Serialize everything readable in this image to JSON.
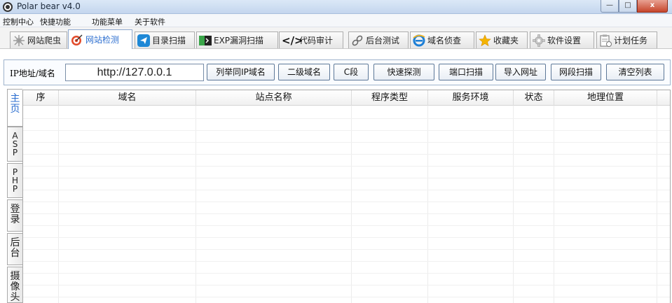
{
  "window": {
    "title": "Polar bear v4.0",
    "min": "—",
    "max": "□",
    "close": "x"
  },
  "menu": [
    "控制中心",
    "快捷功能",
    "功能菜单",
    "关于软件"
  ],
  "tabs": [
    {
      "label": "网站爬虫",
      "icon": "spider-icon"
    },
    {
      "label": "网站检测",
      "icon": "target-icon"
    },
    {
      "label": "目录扫描",
      "icon": "send-icon"
    },
    {
      "label": "EXP漏洞扫描",
      "icon": "terminal-icon"
    },
    {
      "label": "代码审计",
      "icon": "code-icon",
      "glyph": "</>"
    },
    {
      "label": "后台测试",
      "icon": "link-icon"
    },
    {
      "label": "域名侦查",
      "icon": "ie-icon"
    },
    {
      "label": "收藏夹",
      "icon": "star-icon"
    },
    {
      "label": "软件设置",
      "icon": "gear-icon"
    },
    {
      "label": "计划任务",
      "icon": "clipboard-icon"
    }
  ],
  "toolbar": {
    "ip_label": "IP地址/域名",
    "ip_value": "http://127.0.0.1",
    "buttons": [
      "列举同IP域名",
      "二级域名",
      "C段",
      "快速探测",
      "端口扫描",
      "导入网址",
      "网段扫描",
      "清空列表"
    ]
  },
  "side_tabs": [
    "主页",
    "ASP",
    "PHP",
    "登录",
    "后台",
    "摄像头"
  ],
  "table": {
    "columns": [
      "序",
      "域名",
      "站点名称",
      "程序类型",
      "服务环境",
      "状态",
      "地理位置"
    ]
  },
  "colors": {
    "accent": "#2d6fd0",
    "border": "#a8a8a8"
  }
}
